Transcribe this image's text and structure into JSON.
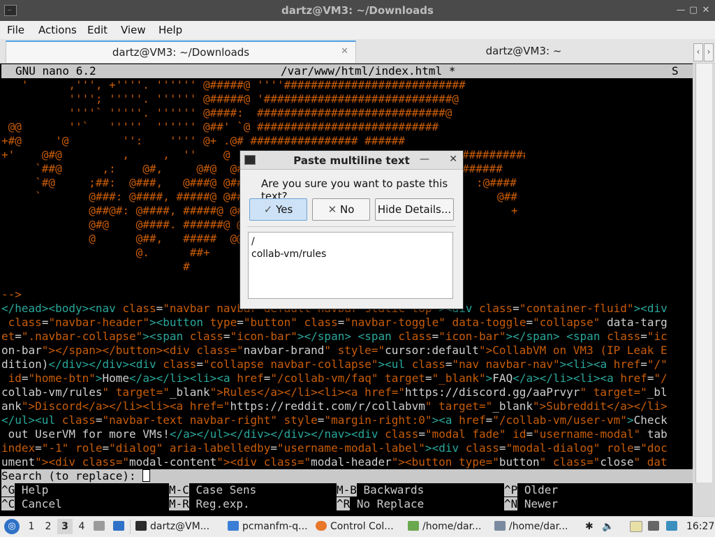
{
  "window": {
    "title": "dartz@VM3: ~/Downloads"
  },
  "menu": [
    "File",
    "Actions",
    "Edit",
    "View",
    "Help"
  ],
  "tabs": [
    {
      "label": "dartz@VM3: ~/Downloads",
      "close": "✕"
    },
    {
      "label": "dartz@VM3: ~"
    }
  ],
  "nano": {
    "version": "GNU nano 6.2",
    "filename": "/var/www/html/index.html *",
    "flag": "S"
  },
  "ascii_lines": [
    "   '      ,''', +''''. '''''' @#####@ ''''###########################",
    "          ''''; '''''. '''''' @#####@ '############################@",
    "          ''''` '''''. '''''' @####:  ############################@",
    " @@       ''`   '''''  '''''' @##' `@ ###########################",
    "+#@     '@        '':    '''' @+ .@# ################ ######",
    "+'    @#@         ,     ,  ''    @   :##",
    "     `##@      ,:    @#,     @#@  @##  ",
    "     `#@     ;##:  @###,   @###@ @##",
    "     `       @###: @####, #####@ @##",
    "             @##@#: @####, #####@ @##",
    "             @#@    @####. ######@ @##",
    "             @      @##,   #####  @@,",
    "                    @.      ##+     ;",
    "                           #"
  ],
  "ascii_right": [
    "##########",
    "######",
    ":@####",
    "@##",
    "+"
  ],
  "comment_end": "-->",
  "html_lines": [
    "</head><body><nav class=\"navbar navbar-default navbar-static-top\"><div class=\"container-fluid\"><div",
    " class=\"navbar-header\"><button type=\"button\" class=\"navbar-toggle\" data-toggle=\"collapse\" data-targ",
    "et=\".navbar-collapse\"><span class=\"icon-bar\"></span> <span class=\"icon-bar\"></span> <span class=\"ic",
    "on-bar\"></span></button><div class=\"navbar-brand\" style=\"cursor:default\">CollabVM on VM3 (IP Leak E",
    "dition)</div></div><div class=\"collapse navbar-collapse\"><ul class=\"nav navbar-nav\"><li><a href=\"/\"",
    " id=\"home-btn\">Home</a></li><li><a href=\"/collab-vm/faq\" target=\"_blank\">FAQ</a></li><li><a href=\"/",
    "collab-vm/rules\" target=\"_blank\">Rules</a></li><li><a href=\"https://discord.gg/aaPrvyr\" target=\"_bl",
    "ank\">Discord</a></li><li><a href=\"https://reddit.com/r/collabvm\" target=\"_blank\">Subreddit</a></li>",
    "</ul><ul class=\"navbar-text navbar-right\" style=\"margin-right:0\"><a href=\"/collab-vm/user-vm\">Check",
    " out UserVM for more VMs!</a></ul></div></div></nav><div class=\"modal fade\" id=\"username-modal\" tab",
    "index=\"-1\" role=\"dialog\" aria-labelledby=\"username-modal-label\"><div class=\"modal-dialog\" role=\"doc",
    "ument\"><div class=\"modal-content\"><div class=\"modal-header\"><button type=\"button\" class=\"close\" dat"
  ],
  "search_prompt": "Search (to replace): ",
  "shortcuts": [
    {
      "key": "^G",
      "label": "Help"
    },
    {
      "key": "^C",
      "label": "Cancel"
    },
    {
      "key": "M-C",
      "label": "Case Sens"
    },
    {
      "key": "M-R",
      "label": "Reg.exp."
    },
    {
      "key": "M-B",
      "label": "Backwards"
    },
    {
      "key": "^R",
      "label": "No Replace"
    },
    {
      "key": "^P",
      "label": "Older"
    },
    {
      "key": "^N",
      "label": "Newer"
    }
  ],
  "dialog": {
    "title": "Paste multiline text",
    "question": "Are you sure you want to paste this text?",
    "yes": "Yes",
    "no": "No",
    "hide": "Hide Details...",
    "text_line1": "/",
    "text_line2": "collab-vm/rules"
  },
  "taskbar": {
    "workspaces": [
      "1",
      "2",
      "3",
      "4"
    ],
    "active_workspace": "3",
    "items": [
      "dartz@VM...",
      "pcmanfm-q...",
      "Control Col...",
      "/home/dar...",
      "/home/dar..."
    ],
    "clock": "16:27"
  },
  "colors": {
    "tag": "#2aa79b",
    "attr": "#c85c08",
    "accent": "#4ea0e6"
  }
}
